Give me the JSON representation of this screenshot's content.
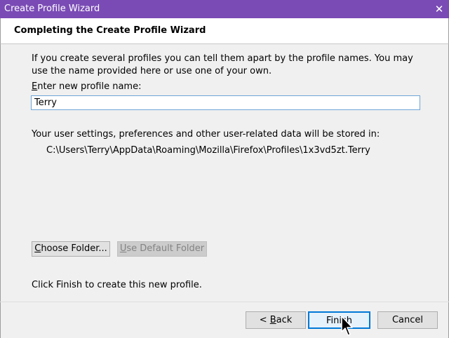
{
  "window": {
    "title": "Create Profile Wizard",
    "close_glyph": "✕"
  },
  "header": {
    "title": "Completing the Create Profile Wizard"
  },
  "content": {
    "intro": "If you create several profiles you can tell them apart by the profile names. You may use the name provided here or use one of your own.",
    "name_label_accel": "E",
    "name_label_rest": "nter new profile name:",
    "name_value": "Terry",
    "store_label": "Your user settings, preferences and other user-related data will be stored in:",
    "path": "C:\\Users\\Terry\\AppData\\Roaming\\Mozilla\\Firefox\\Profiles\\1x3vd5zt.Terry",
    "choose_folder_accel": "C",
    "choose_folder_rest": "hoose Folder...",
    "use_default_accel": "U",
    "use_default_rest": "se Default Folder",
    "finish_message": "Click Finish to create this new profile."
  },
  "footer": {
    "back_prefix": "< ",
    "back_accel": "B",
    "back_rest": "ack",
    "finish_label": "Finish",
    "cancel_label": "Cancel"
  },
  "colors": {
    "titlebar": "#7a4bb5",
    "focus_border": "#0078d7"
  },
  "icons": {
    "close": "close-icon",
    "cursor": "mouse-pointer-icon"
  }
}
